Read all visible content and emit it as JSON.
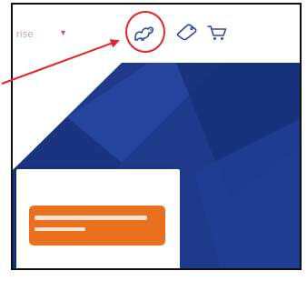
{
  "nav": {
    "menu_label": "rise",
    "chevron": "▾"
  },
  "icons": [
    {
      "name": "dog-icon",
      "highlighted": true
    },
    {
      "name": "tag-icon",
      "highlighted": false
    },
    {
      "name": "cart-icon",
      "highlighted": false
    }
  ],
  "colors": {
    "accent": "#e0466e",
    "annotation_red": "#e0262b",
    "hero_blue": "#1f3a8a",
    "cta_orange": "#e8701f",
    "icon_blue": "#2c4aa6"
  }
}
